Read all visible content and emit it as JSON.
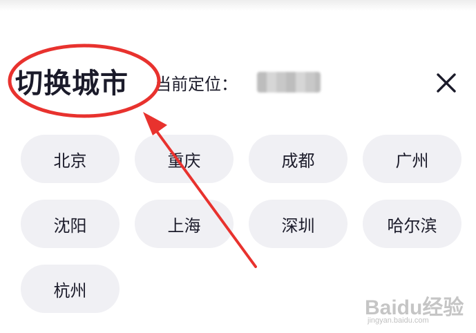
{
  "header": {
    "title": "切换城市",
    "location_label": "当前定位：",
    "location_value": "",
    "close_icon": "close-icon"
  },
  "cities": [
    "北京",
    "重庆",
    "成都",
    "广州",
    "沈阳",
    "上海",
    "深圳",
    "哈尔滨",
    "杭州"
  ],
  "watermark": {
    "brand": "Baidu经验",
    "url": "jingyan.baidu.com"
  },
  "colors": {
    "text": "#1b1b2a",
    "chip_bg": "#f0f0f4",
    "annotation": "#e8322e"
  }
}
